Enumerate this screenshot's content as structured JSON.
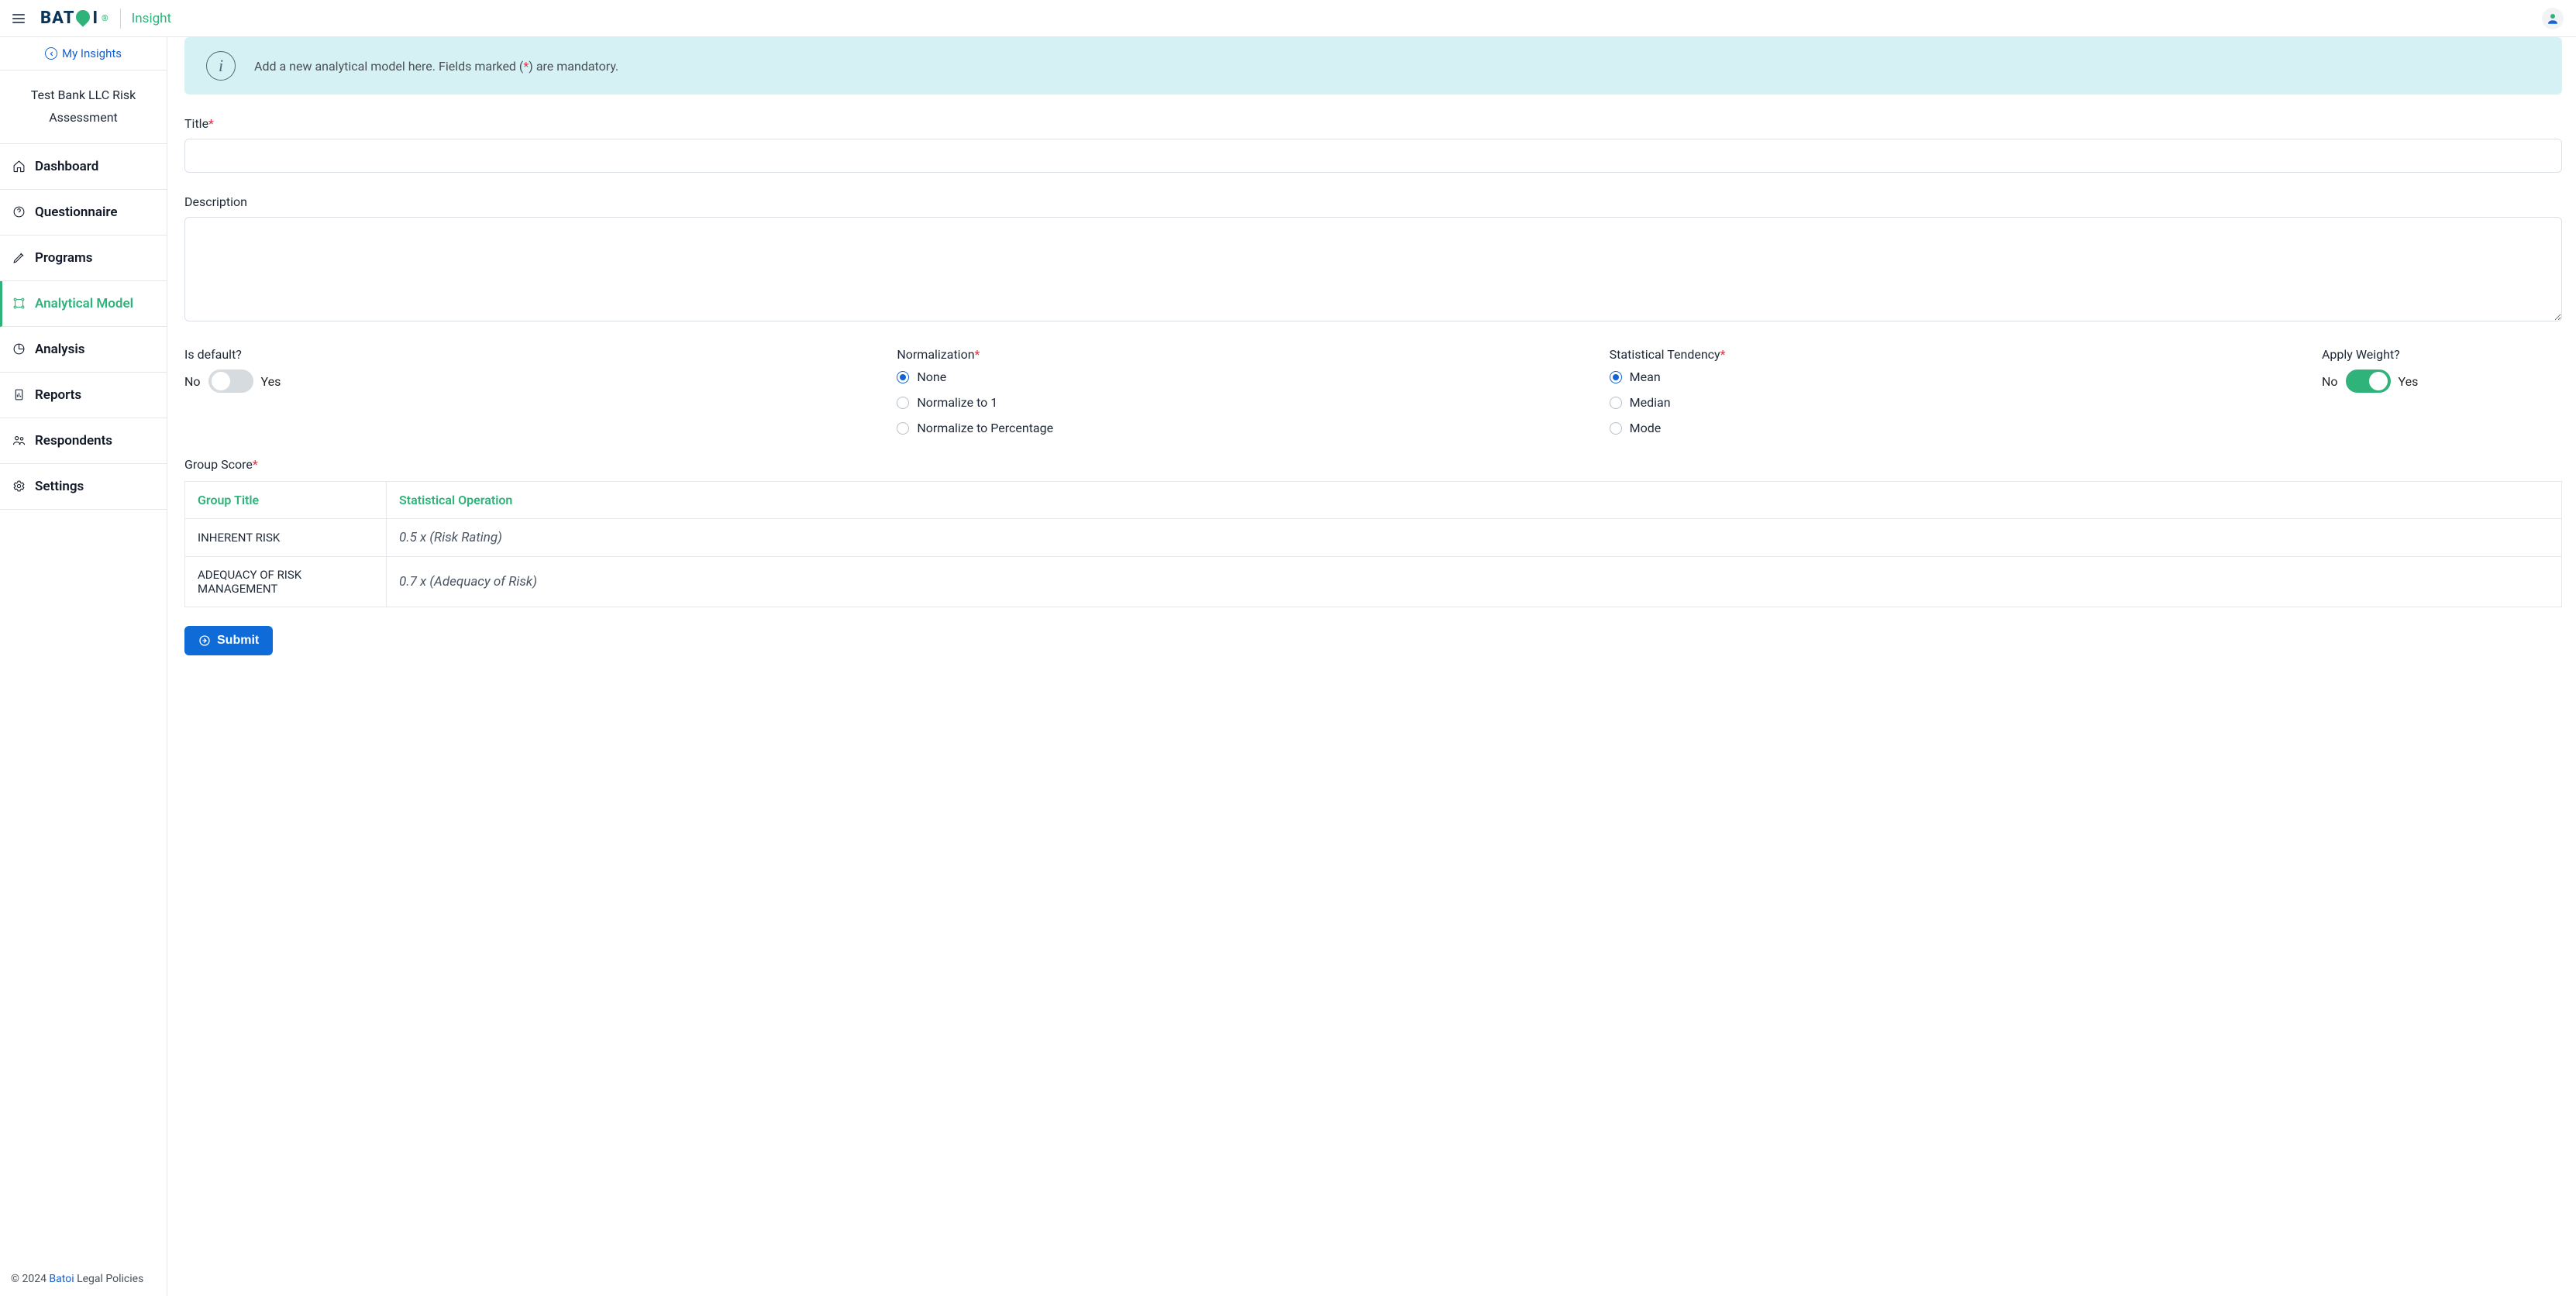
{
  "header": {
    "product": "Insight",
    "logo_text_a": "BAT",
    "logo_text_b": "I",
    "logo_reg": "®"
  },
  "sidebar": {
    "my_insights": "My Insights",
    "title": "Test Bank LLC Risk Assessment",
    "items": [
      {
        "key": "dashboard",
        "label": "Dashboard",
        "active": false
      },
      {
        "key": "questionnaire",
        "label": "Questionnaire",
        "active": false
      },
      {
        "key": "programs",
        "label": "Programs",
        "active": false
      },
      {
        "key": "analytical-model",
        "label": "Analytical Model",
        "active": true
      },
      {
        "key": "analysis",
        "label": "Analysis",
        "active": false
      },
      {
        "key": "reports",
        "label": "Reports",
        "active": false
      },
      {
        "key": "respondents",
        "label": "Respondents",
        "active": false
      },
      {
        "key": "settings",
        "label": "Settings",
        "active": false
      }
    ],
    "footer": {
      "copyright": "© 2024 ",
      "brand": "Batoi",
      "legal": " Legal Policies"
    }
  },
  "banner": {
    "text_pre": "Add a new analytical model here. Fields marked (",
    "star": "*",
    "text_post": ") are mandatory."
  },
  "form": {
    "title_label": "Title",
    "title_value": "",
    "description_label": "Description",
    "description_value": "",
    "is_default_label": "Is default?",
    "no": "No",
    "yes": "Yes",
    "is_default_on": false,
    "normalization_label": "Normalization",
    "normalization_options": {
      "none": "None",
      "to1": "Normalize to 1",
      "pct": "Normalize to Percentage"
    },
    "normalization_selected": "none",
    "stat_label": "Statistical Tendency",
    "stat_options": {
      "mean": "Mean",
      "median": "Median",
      "mode": "Mode"
    },
    "stat_selected": "mean",
    "apply_weight_label": "Apply Weight?",
    "apply_weight_on": true,
    "group_score_label": "Group Score",
    "table": {
      "headers": {
        "title": "Group Title",
        "op": "Statistical Operation"
      },
      "rows": [
        {
          "title": "INHERENT RISK",
          "op": "0.5 x (Risk Rating)"
        },
        {
          "title": "ADEQUACY OF RISK MANAGEMENT",
          "op": "0.7 x (Adequacy of Risk)"
        }
      ]
    },
    "submit_label": "Submit"
  }
}
